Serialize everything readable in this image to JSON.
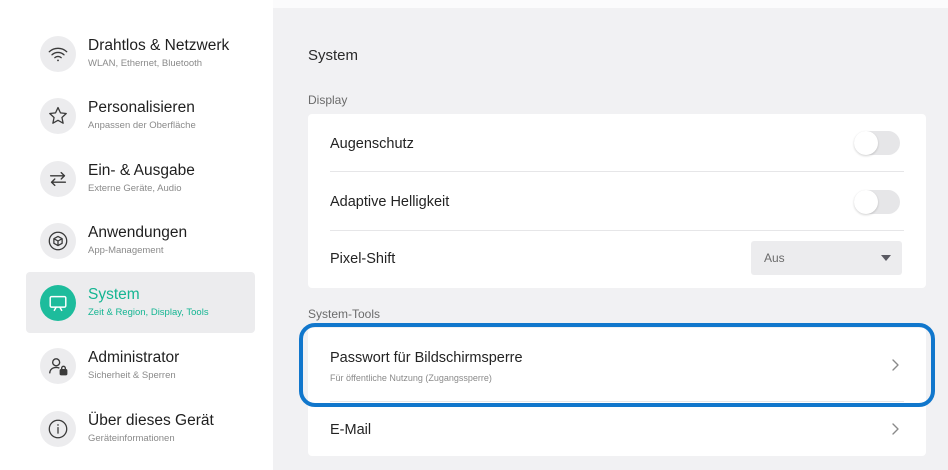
{
  "sidebar": {
    "items": [
      {
        "label": "Drahtlos & Netzwerk",
        "sub": "WLAN, Ethernet, Bluetooth",
        "icon": "wifi-icon",
        "active": false
      },
      {
        "label": "Personalisieren",
        "sub": "Anpassen der Oberfläche",
        "icon": "star-icon",
        "active": false
      },
      {
        "label": "Ein- & Ausgabe",
        "sub": "Externe Geräte, Audio",
        "icon": "swap-arrows-icon",
        "active": false
      },
      {
        "label": "Anwendungen",
        "sub": "App-Management",
        "icon": "cube-icon",
        "active": false
      },
      {
        "label": "System",
        "sub": "Zeit & Region, Display, Tools",
        "icon": "monitor-icon",
        "active": true
      },
      {
        "label": "Administrator",
        "sub": "Sicherheit & Sperren",
        "icon": "user-lock-icon",
        "active": false
      },
      {
        "label": "Über dieses Gerät",
        "sub": "Geräteinformationen",
        "icon": "info-icon",
        "active": false
      }
    ]
  },
  "main": {
    "title": "System",
    "display_section": {
      "label": "Display",
      "augenschutz": {
        "label": "Augenschutz",
        "enabled": false
      },
      "adaptive": {
        "label": "Adaptive Helligkeit",
        "enabled": false
      },
      "pixel_shift": {
        "label": "Pixel-Shift",
        "value": "Aus"
      }
    },
    "tools_section": {
      "label": "System-Tools",
      "password": {
        "label": "Passwort für Bildschirmsperre",
        "sub": "Für öffentliche Nutzung (Zugangssperre)"
      },
      "email": {
        "label": "E-Mail"
      }
    }
  },
  "colors": {
    "accent": "#1dbc9c",
    "accent_text": "#14b592",
    "highlight": "#1177cc",
    "background": "#f1f1f3"
  }
}
